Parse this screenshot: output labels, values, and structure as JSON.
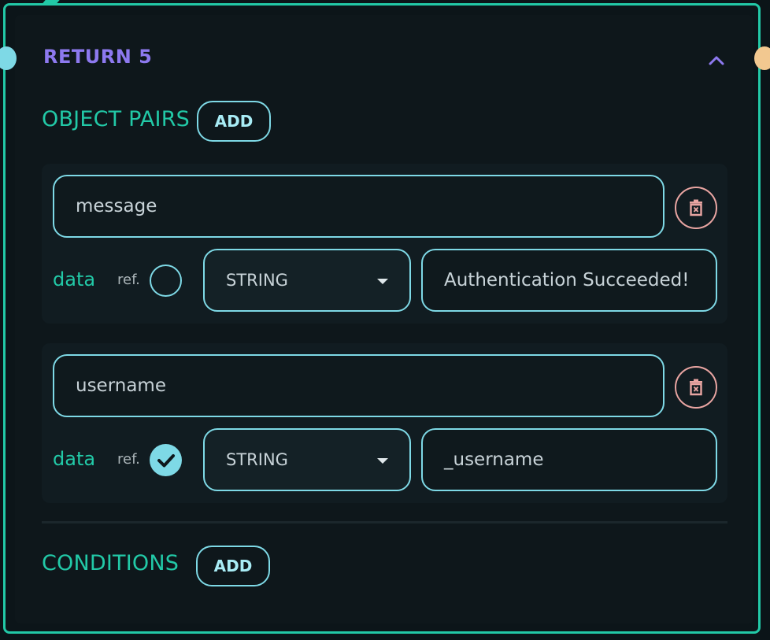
{
  "node": {
    "title": "RETURN 5",
    "colors": {
      "accent": "#22c9a7",
      "title": "#8d79ef",
      "input_border": "#7ed9e6",
      "delete": "#e9a5a2",
      "handle_in": "#7ed9e6",
      "handle_out": "#f2c890"
    }
  },
  "object_pairs": {
    "label": "OBJECT PAIRS",
    "add_label": "ADD",
    "items": [
      {
        "key": "message",
        "data_label": "data",
        "ref_label": "ref.",
        "ref_checked": false,
        "type": "STRING",
        "value": "Authentication Succeeded!"
      },
      {
        "key": "username",
        "data_label": "data",
        "ref_label": "ref.",
        "ref_checked": true,
        "type": "STRING",
        "value": "_username"
      }
    ]
  },
  "conditions": {
    "label": "CONDITIONS",
    "add_label": "ADD"
  },
  "icons": {
    "collapse": "chevron-up-icon",
    "delete": "trash-icon",
    "ref_checked": "check-icon"
  }
}
